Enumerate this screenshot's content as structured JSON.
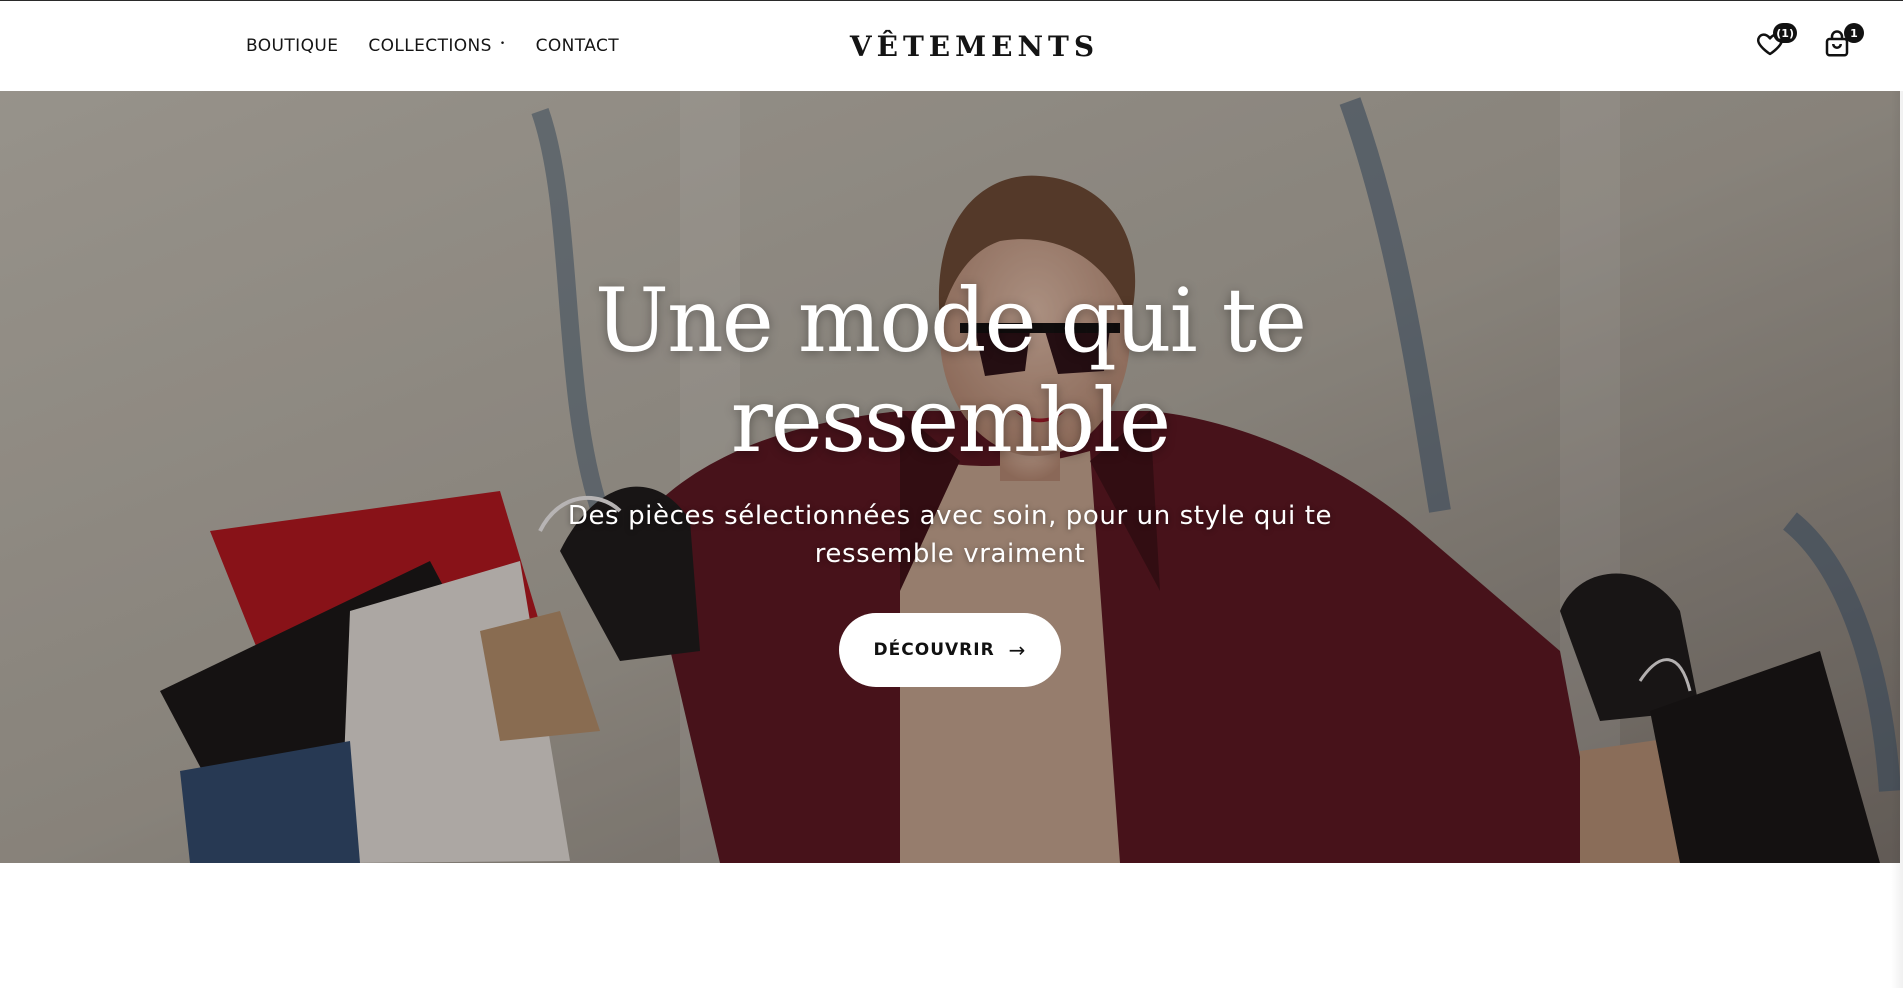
{
  "nav": {
    "items": [
      {
        "label": "BOUTIQUE",
        "has_caret": false
      },
      {
        "label": "COLLECTIONS",
        "has_caret": true
      },
      {
        "label": "CONTACT",
        "has_caret": false
      }
    ],
    "caret_symbol": "•",
    "logo": "VÊTEMENTS",
    "wishlist_badge": "(1)",
    "cart_badge": "1",
    "icons": [
      "heart-icon",
      "shopping-bag-icon"
    ]
  },
  "hero": {
    "title": "Une mode qui te ressemble",
    "subtitle": "Des pièces sélectionnées avec soin, pour un style qui te ressemble vraiment",
    "cta_label": "DÉCOUVRIR",
    "cta_arrow": "→"
  },
  "colors": {
    "text_dark": "#111111",
    "coat_red": "#6e1a24",
    "cta_bg": "#ffffff"
  }
}
